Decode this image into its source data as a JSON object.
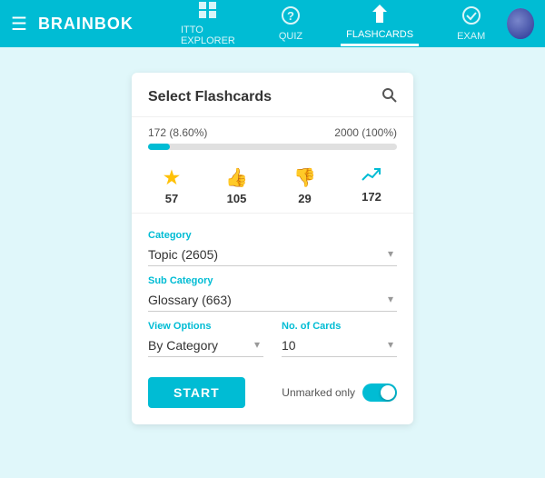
{
  "header": {
    "brand": "BRAINBOK",
    "menu_icon": "☰",
    "nav": [
      {
        "id": "itto-explorer",
        "label": "ITTO EXPLORER",
        "icon": "⊞",
        "active": false
      },
      {
        "id": "quiz",
        "label": "QUIZ",
        "icon": "?",
        "active": false
      },
      {
        "id": "flashcards",
        "label": "FLASHCARDS",
        "icon": "⚡",
        "active": true
      },
      {
        "id": "exam",
        "label": "EXAM",
        "icon": "✓",
        "active": false
      }
    ]
  },
  "card": {
    "title": "Select Flashcards",
    "progress": {
      "current_label": "172 (8.60%)",
      "total_label": "2000 (100%)",
      "fill_percent": 8.6
    },
    "stats": [
      {
        "id": "starred",
        "value": "57",
        "icon_name": "star-icon"
      },
      {
        "id": "thumbup",
        "value": "105",
        "icon_name": "thumbup-icon"
      },
      {
        "id": "thumbdown",
        "value": "29",
        "icon_name": "thumbdown-icon"
      },
      {
        "id": "trend",
        "value": "172",
        "icon_name": "trend-icon"
      }
    ],
    "category": {
      "label": "Category",
      "value": "Topic (2605)"
    },
    "subcategory": {
      "label": "Sub Category",
      "value": "Glossary (663)"
    },
    "view_options": {
      "label": "View Options",
      "value": "By Category"
    },
    "num_cards": {
      "label": "No. of Cards",
      "value": "10"
    },
    "start_button": "START",
    "unmarked_label": "Unmarked only",
    "toggle_on": true
  }
}
